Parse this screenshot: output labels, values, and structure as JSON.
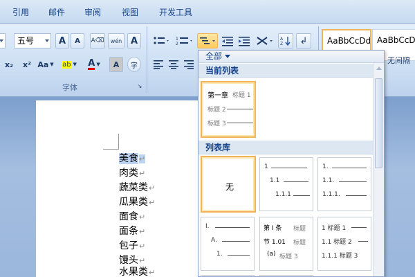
{
  "tabs": [
    "引用",
    "邮件",
    "审阅",
    "视图",
    "开发工具"
  ],
  "font_group": {
    "size_value": "五号",
    "label": "字体",
    "grow_label": "A",
    "shrink_label": "A",
    "phonetic_label": "wén",
    "border_char_label": "A",
    "subscript_label": "x₂",
    "superscript_label": "x²",
    "case_label": "Aa",
    "highlight_label": "ab",
    "font_color_label": "A",
    "shade_label": "A",
    "enclose_label": "字"
  },
  "styles": {
    "normal_preview": "AaBbCcDd",
    "nospacing_preview": "AaBbCcDd",
    "nospacing_label": "无间隔"
  },
  "dropdown": {
    "filter_label": "全部",
    "section_current": "当前列表",
    "section_library": "列表库",
    "none_label": "无",
    "current_tile": [
      "第一章",
      "标题 1",
      "标题 2",
      "标题 3"
    ],
    "lib_tile_2": [
      "1",
      "1.1",
      "1.1.1"
    ],
    "lib_tile_3": [
      "1.",
      "1.1.",
      "1.1.1."
    ],
    "lib_tile_4": [
      "I.",
      "A.",
      "1."
    ],
    "lib_tile_5": [
      "第 I 条",
      "标题",
      "节 1.01",
      "标题",
      "(a)",
      "标题 3"
    ],
    "lib_tile_6": [
      "1 标题 1",
      "1.1 标题 2",
      "1.1.1 标题 3"
    ]
  },
  "document": {
    "lines": [
      "美食",
      "肉类",
      "蔬菜类",
      "瓜果类",
      "面食",
      "面条",
      "包子",
      "馒头",
      "水果类"
    ],
    "para_mark": "↵"
  },
  "colors": {
    "accent_orange": "#f0b55a",
    "ribbon_blue": "#c9dcf2",
    "text_blue": "#15428b",
    "selection": "#bcd3f1"
  }
}
